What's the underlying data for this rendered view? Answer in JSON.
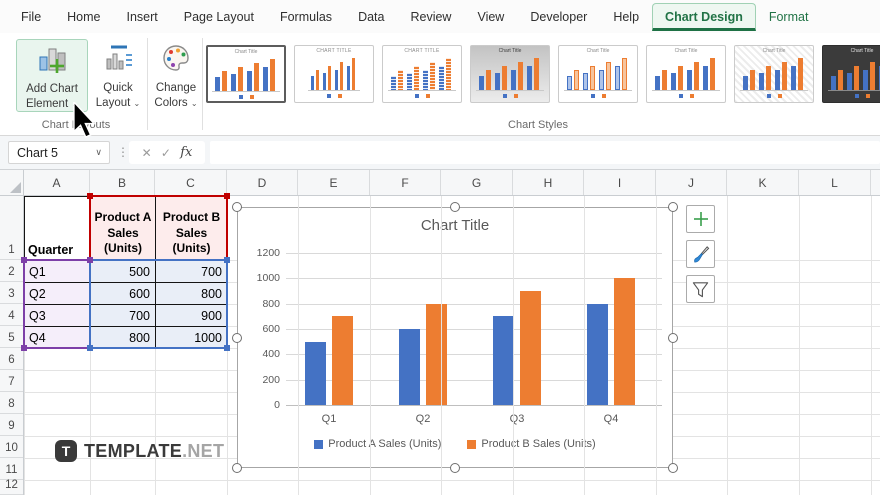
{
  "ribbon": {
    "tabs": [
      "File",
      "Home",
      "Insert",
      "Page Layout",
      "Formulas",
      "Data",
      "Review",
      "View",
      "Developer",
      "Help",
      "Chart Design",
      "Format"
    ],
    "active_tab": "Chart Design",
    "contextual_tabs": [
      "Chart Design",
      "Format"
    ],
    "chart_layouts": {
      "group_label": "Chart Layouts",
      "add_chart_element": {
        "line1": "Add Chart",
        "line2": "Element"
      },
      "quick_layout": {
        "line1": "Quick",
        "line2": "Layout"
      }
    },
    "change_colors": {
      "line1": "Change",
      "line2": "Colors"
    },
    "chart_styles": {
      "group_label": "Chart Styles",
      "thumb_title": "Chart Title",
      "styles": [
        {
          "name": "chart-style-1",
          "variant": "light",
          "selected": true
        },
        {
          "name": "chart-style-2",
          "variant": "caps-thin",
          "selected": false
        },
        {
          "name": "chart-style-3",
          "variant": "striped",
          "selected": false
        },
        {
          "name": "chart-style-4",
          "variant": "gray",
          "selected": false
        },
        {
          "name": "chart-style-5",
          "variant": "outline",
          "selected": false
        },
        {
          "name": "chart-style-6",
          "variant": "plain",
          "selected": false
        },
        {
          "name": "chart-style-7",
          "variant": "hatched",
          "selected": false
        },
        {
          "name": "chart-style-8",
          "variant": "dark",
          "selected": false
        }
      ]
    }
  },
  "formula_bar": {
    "name_box_value": "Chart 5",
    "cancel_icon": "✕",
    "enter_icon": "✓",
    "fx_label": "fx",
    "formula_value": ""
  },
  "grid": {
    "column_headers": [
      "A",
      "B",
      "C",
      "D",
      "E",
      "F",
      "G",
      "H",
      "I",
      "J",
      "K",
      "L"
    ],
    "row_headers": [
      "1",
      "2",
      "3",
      "4",
      "5",
      "6",
      "7",
      "8",
      "9",
      "10",
      "11",
      "12"
    ],
    "table": {
      "headers": [
        "Quarter",
        "Product A Sales (Units)",
        "Product B Sales (Units)"
      ],
      "rows": [
        [
          "Q1",
          "500",
          "700"
        ],
        [
          "Q2",
          "600",
          "800"
        ],
        [
          "Q3",
          "700",
          "900"
        ],
        [
          "Q4",
          "800",
          "1000"
        ]
      ]
    }
  },
  "chart_data": {
    "type": "bar",
    "title": "Chart Title",
    "categories": [
      "Q1",
      "Q2",
      "Q3",
      "Q4"
    ],
    "series": [
      {
        "name": "Product A Sales (Units)",
        "color": "#4472c4",
        "values": [
          500,
          600,
          700,
          800
        ]
      },
      {
        "name": "Product B Sales (Units)",
        "color": "#ed7d31",
        "values": [
          700,
          800,
          900,
          1000
        ]
      }
    ],
    "ylim": [
      0,
      1200
    ],
    "yticks": [
      0,
      200,
      400,
      600,
      800,
      1000,
      1200
    ],
    "grid": true,
    "legend_position": "bottom"
  },
  "chart_tools": [
    "chart-elements",
    "chart-styles",
    "chart-filters"
  ],
  "watermark": {
    "icon_letter": "T",
    "brand": "TEMPLATE",
    "suffix": ".NET"
  },
  "colors": {
    "accent_green": "#217346",
    "series_blue": "#4472c4",
    "series_orange": "#ed7d31",
    "range_red": "#c00000",
    "range_purple": "#7d3fa8",
    "range_blue": "#4472c4"
  }
}
